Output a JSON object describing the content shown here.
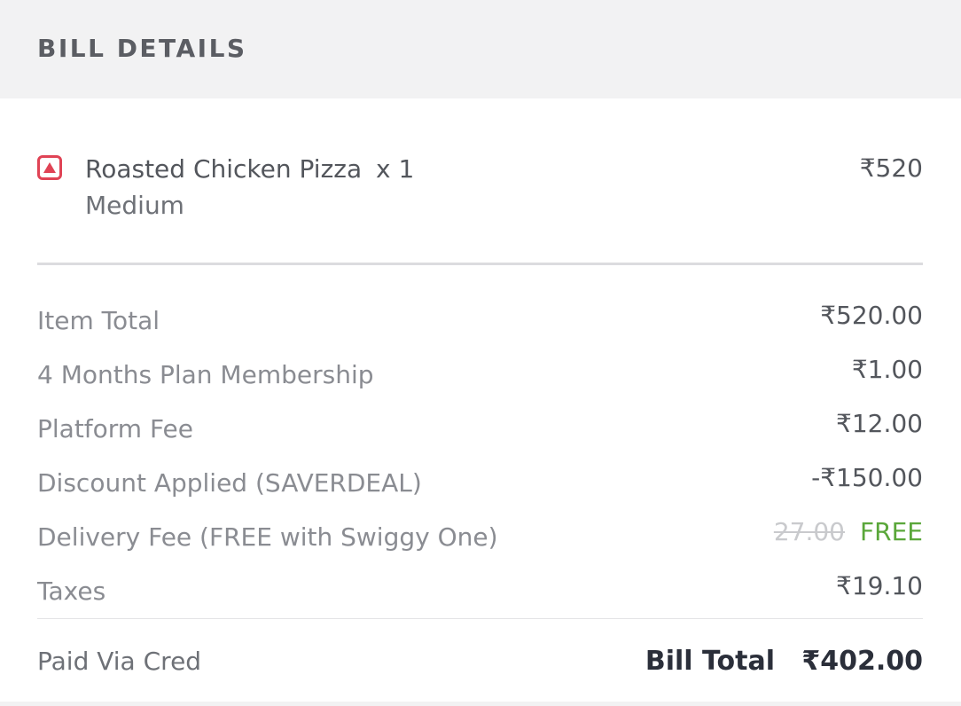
{
  "header": {
    "title": "BILL DETAILS"
  },
  "item": {
    "icon": "non-veg-icon",
    "icon_color": "#e04355",
    "name": "Roasted Chicken Pizza",
    "quantity": "x 1",
    "variant": "Medium",
    "price": "₹520"
  },
  "charges": [
    {
      "label": "Item Total",
      "value": "₹520.00"
    },
    {
      "label": "4 Months Plan Membership",
      "value": "₹1.00"
    },
    {
      "label": "Platform Fee",
      "value": "₹12.00"
    },
    {
      "label": "Discount Applied (SAVERDEAL)",
      "value": "-₹150.00"
    },
    {
      "label": "Delivery Fee (FREE with Swiggy One)",
      "original_value": "27.00",
      "value": "FREE"
    },
    {
      "label": "Taxes",
      "value": "₹19.10"
    }
  ],
  "footer": {
    "payment_method": "Paid Via Cred",
    "total_label": "Bill Total",
    "total_value": "₹402.00"
  },
  "colors": {
    "free_green": "#5aa73a",
    "header_bg": "#f2f2f3",
    "total_text": "#2b2f3a"
  }
}
